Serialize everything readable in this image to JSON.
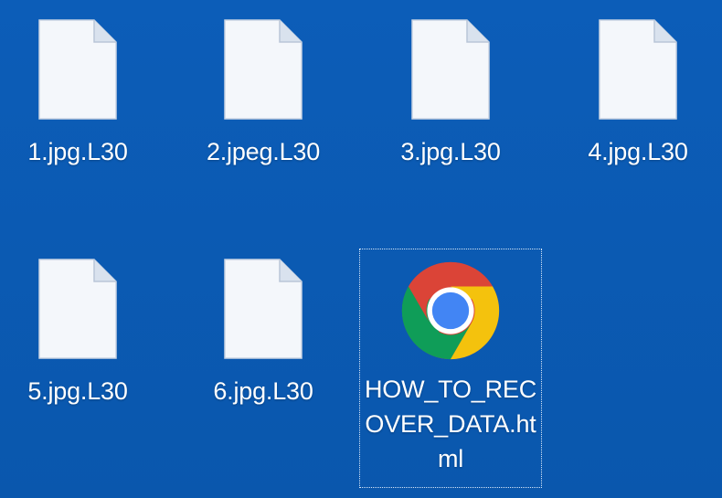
{
  "desktop": {
    "background_color": "#0b59b3",
    "files": [
      {
        "name": "1.jpg.L30",
        "icon": "blank-file-icon"
      },
      {
        "name": "2.jpeg.L30",
        "icon": "blank-file-icon"
      },
      {
        "name": "3.jpg.L30",
        "icon": "blank-file-icon"
      },
      {
        "name": "4.jpg.L30",
        "icon": "blank-file-icon"
      },
      {
        "name": "5.jpg.L30",
        "icon": "blank-file-icon"
      },
      {
        "name": "6.jpg.L30",
        "icon": "blank-file-icon"
      },
      {
        "name": "HOW_TO_RECOVER_DATA.html",
        "icon": "chrome-icon",
        "selected": true
      }
    ]
  }
}
